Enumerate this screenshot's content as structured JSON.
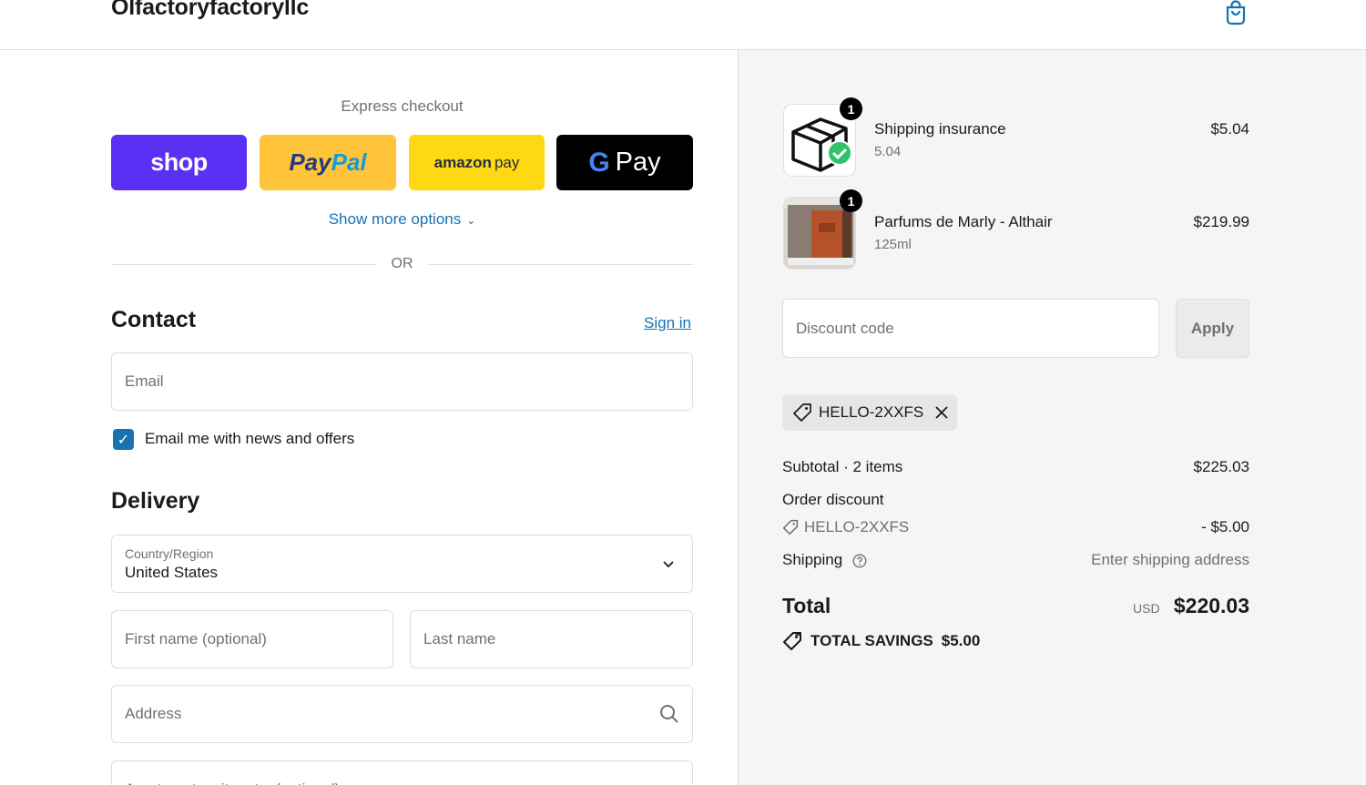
{
  "header": {
    "brand": "Olfactoryfactoryllc",
    "cart_icon": "shopping-bag-icon"
  },
  "express": {
    "title": "Express checkout",
    "shop_label": "shop",
    "paypal_part1": "Pay",
    "paypal_part2": "Pal",
    "amazon_part1": "amazon",
    "amazon_part2": "pay",
    "gpay_g": "G",
    "gpay_label": "Pay",
    "more_options": "Show more options",
    "or": "OR"
  },
  "contact": {
    "title": "Contact",
    "signin": "Sign in",
    "email_placeholder": "Email",
    "newsletter_label": "Email me with news and offers",
    "newsletter_checked": true
  },
  "delivery": {
    "title": "Delivery",
    "country_label": "Country/Region",
    "country_value": "United States",
    "first_name_placeholder": "First name (optional)",
    "last_name_placeholder": "Last name",
    "address_placeholder": "Address",
    "apartment_placeholder": "Apartment, suite, etc. (optional)"
  },
  "summary": {
    "items": [
      {
        "name": "Shipping insurance",
        "sub": "5.04",
        "price": "$5.04",
        "qty": "1",
        "icon": "package-check-icon"
      },
      {
        "name": "Parfums de Marly - Althair",
        "sub": "125ml",
        "price": "$219.99",
        "qty": "1",
        "icon": "perfume-box-image"
      }
    ],
    "discount_placeholder": "Discount code",
    "apply_label": "Apply",
    "applied_code": "HELLO-2XXFS",
    "subtotal_label": "Subtotal · 2 items",
    "subtotal_value": "$225.03",
    "order_discount_label": "Order discount",
    "discount_code": "HELLO-2XXFS",
    "discount_value": "- $5.00",
    "shipping_label": "Shipping",
    "shipping_value": "Enter shipping address",
    "total_label": "Total",
    "currency": "USD",
    "total_value": "$220.03",
    "savings_label": "TOTAL SAVINGS",
    "savings_value": "$5.00"
  },
  "colors": {
    "accent": "#1773b0",
    "shop": "#5a31f4",
    "paypal": "#ffc439",
    "amazon": "#ffd814",
    "gpay": "#000000"
  }
}
